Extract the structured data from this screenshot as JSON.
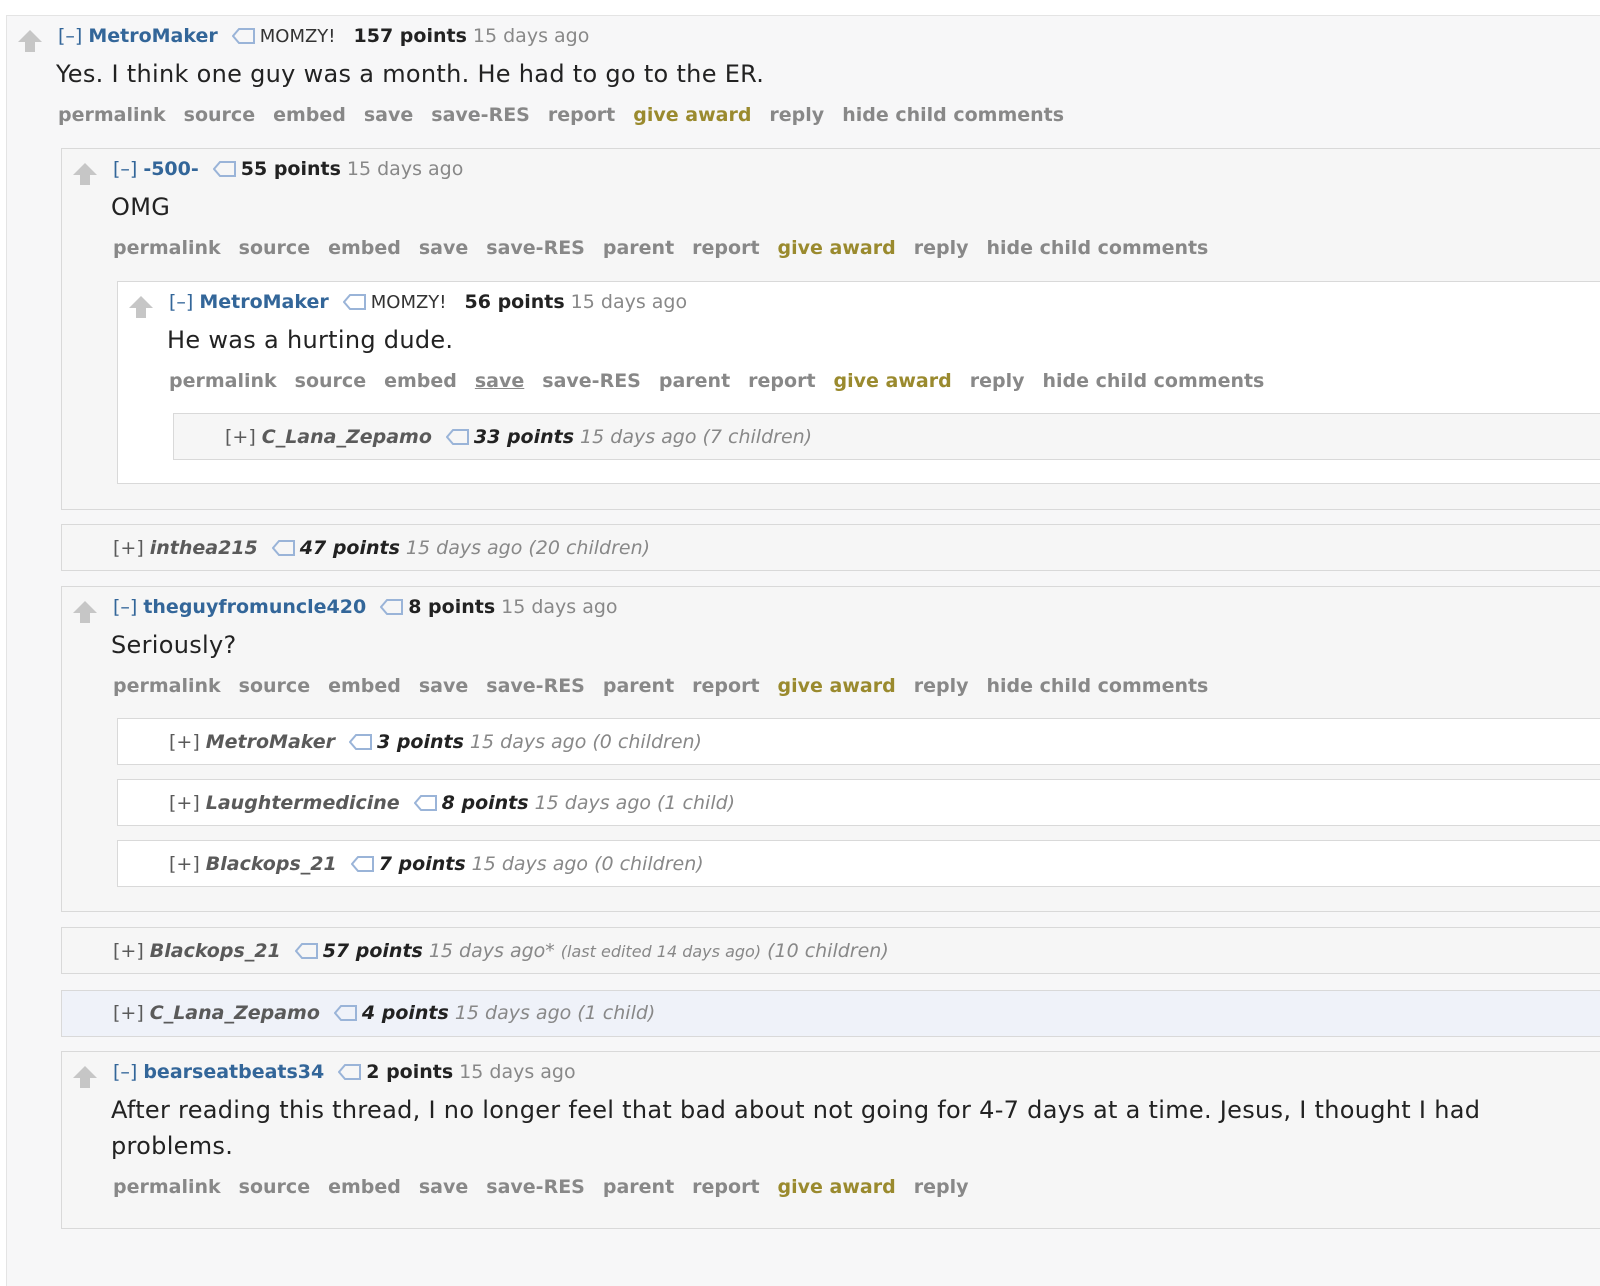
{
  "colors": {
    "author_link": "#336699",
    "action_link": "#888888",
    "award": "#9a8a2e",
    "tag_icon": "#9ab4d8"
  },
  "c1": {
    "expander": "[–]",
    "author": "MetroMaker",
    "flair": "MOMZY!",
    "points": "157 points",
    "time": "15 days ago",
    "body": "Yes. I think one guy was a month. He had to go to the ER.",
    "buttons": {
      "permalink": "permalink",
      "source": "source",
      "embed": "embed",
      "save": "save",
      "save_res": "save-RES",
      "report": "report",
      "give_award": "give award",
      "reply": "reply",
      "hide_child": "hide child comments"
    }
  },
  "c2": {
    "expander": "[–]",
    "author": "-500-",
    "points": "55 points",
    "time": "15 days ago",
    "body": "OMG",
    "buttons": {
      "permalink": "permalink",
      "source": "source",
      "embed": "embed",
      "save": "save",
      "save_res": "save-RES",
      "parent": "parent",
      "report": "report",
      "give_award": "give award",
      "reply": "reply",
      "hide_child": "hide child comments"
    }
  },
  "c3": {
    "expander": "[–]",
    "author": "MetroMaker",
    "flair": "MOMZY!",
    "points": "56 points",
    "time": "15 days ago",
    "body": "He was a hurting dude.",
    "buttons": {
      "permalink": "permalink",
      "source": "source",
      "embed": "embed",
      "save": "save",
      "save_res": "save-RES",
      "parent": "parent",
      "report": "report",
      "give_award": "give award",
      "reply": "reply",
      "hide_child": "hide child comments"
    }
  },
  "c4": {
    "expander": "[+]",
    "author": "C_Lana_Zepamo",
    "points": "33 points",
    "time": "15 days ago",
    "children": "(7 children)"
  },
  "c5": {
    "expander": "[+]",
    "author": "inthea215",
    "points": "47 points",
    "time": "15 days ago",
    "children": "(20 children)"
  },
  "c6": {
    "expander": "[–]",
    "author": "theguyfromuncle420",
    "points": "8 points",
    "time": "15 days ago",
    "body": "Seriously?",
    "buttons": {
      "permalink": "permalink",
      "source": "source",
      "embed": "embed",
      "save": "save",
      "save_res": "save-RES",
      "parent": "parent",
      "report": "report",
      "give_award": "give award",
      "reply": "reply",
      "hide_child": "hide child comments"
    }
  },
  "c7": {
    "expander": "[+]",
    "author": "MetroMaker",
    "points": "3 points",
    "time": "15 days ago",
    "children": "(0 children)"
  },
  "c8": {
    "expander": "[+]",
    "author": "Laughtermedicine",
    "points": "8 points",
    "time": "15 days ago",
    "children": "(1 child)"
  },
  "c9": {
    "expander": "[+]",
    "author": "Blackops_21",
    "points": "7 points",
    "time": "15 days ago",
    "children": "(0 children)"
  },
  "c10": {
    "expander": "[+]",
    "author": "Blackops_21",
    "points": "57 points",
    "time": "15 days ago*",
    "edited": "(last edited 14 days ago)",
    "children": "(10 children)"
  },
  "c11": {
    "expander": "[+]",
    "author": "C_Lana_Zepamo",
    "points": "4 points",
    "time": "15 days ago",
    "children": "(1 child)"
  },
  "c12": {
    "expander": "[–]",
    "author": "bearseatbeats34",
    "points": "2 points",
    "time": "15 days ago",
    "body": "After reading this thread, I no longer feel that bad about not going for 4-7 days at a time. Jesus, I thought I had problems.",
    "buttons": {
      "permalink": "permalink",
      "source": "source",
      "embed": "embed",
      "save": "save",
      "save_res": "save-RES",
      "parent": "parent",
      "report": "report",
      "give_award": "give award",
      "reply": "reply"
    }
  }
}
